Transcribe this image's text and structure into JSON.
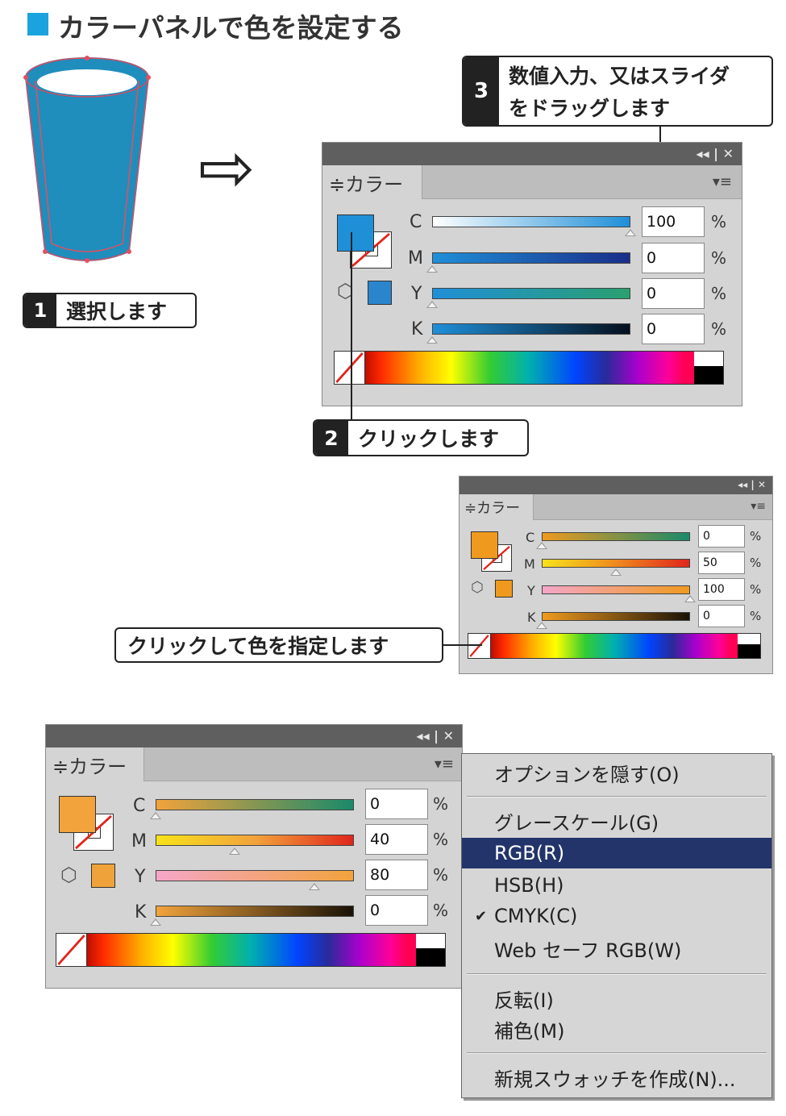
{
  "heading": {
    "title": "カラーパネルで色を設定する",
    "accent": "#1aa3dd"
  },
  "arrow": "⇨",
  "steps": {
    "step1": {
      "num": "1",
      "text": "選択します"
    },
    "step2": {
      "num": "2",
      "text": "クリックします"
    },
    "step3": {
      "num": "3",
      "line1": "数値入力、又はスライダ",
      "line2": "をドラッグします"
    },
    "step4": {
      "text": "クリックして色を指定します"
    }
  },
  "panels": [
    {
      "title_controls": "◂◂ | ✕",
      "tab_label": "≑カラー",
      "menu_icon": "▾≡",
      "fill_color": "#1f8fd8",
      "mini_color": "#2a85cc",
      "rows": [
        {
          "label": "C",
          "value": "100",
          "unit": "%",
          "level": 1.0
        },
        {
          "label": "M",
          "value": "0",
          "unit": "%",
          "level": 0.0
        },
        {
          "label": "Y",
          "value": "0",
          "unit": "%",
          "level": 0.0
        },
        {
          "label": "K",
          "value": "0",
          "unit": "%",
          "level": 0.0
        }
      ]
    },
    {
      "title_controls": "◂◂ | ✕",
      "tab_label": "≑カラー",
      "menu_icon": "▾≡",
      "fill_color": "#ef9a1f",
      "mini_color": "#ef9a1f",
      "rows": [
        {
          "label": "C",
          "value": "0",
          "unit": "%",
          "level": 0.0
        },
        {
          "label": "M",
          "value": "50",
          "unit": "%",
          "level": 0.5
        },
        {
          "label": "Y",
          "value": "100",
          "unit": "%",
          "level": 1.0
        },
        {
          "label": "K",
          "value": "0",
          "unit": "%",
          "level": 0.0
        }
      ]
    },
    {
      "title_controls": "◂◂ | ✕",
      "tab_label": "≑カラー",
      "menu_icon": "▾≡",
      "fill_color": "#f2a33c",
      "mini_color": "#f0a23a",
      "rows": [
        {
          "label": "C",
          "value": "0",
          "unit": "%",
          "level": 0.0
        },
        {
          "label": "M",
          "value": "40",
          "unit": "%",
          "level": 0.4
        },
        {
          "label": "Y",
          "value": "80",
          "unit": "%",
          "level": 0.8
        },
        {
          "label": "K",
          "value": "0",
          "unit": "%",
          "level": 0.0
        }
      ]
    }
  ],
  "context_menu": {
    "items": [
      {
        "label": "オプションを隠す(O)",
        "checked": false,
        "selected": false
      },
      {
        "label": "グレースケール(G)",
        "checked": false,
        "selected": false
      },
      {
        "label": "RGB(R)",
        "checked": false,
        "selected": true
      },
      {
        "label": "HSB(H)",
        "checked": false,
        "selected": false
      },
      {
        "label": "CMYK(C)",
        "checked": true,
        "selected": false
      },
      {
        "label": "Web セーフ RGB(W)",
        "checked": false,
        "selected": false
      },
      {
        "label": "反転(I)",
        "checked": false,
        "selected": false
      },
      {
        "label": "補色(M)",
        "checked": false,
        "selected": false
      },
      {
        "label": "新規スウォッチを作成(N)...",
        "checked": false,
        "selected": false
      }
    ],
    "check_mark": "✔"
  }
}
